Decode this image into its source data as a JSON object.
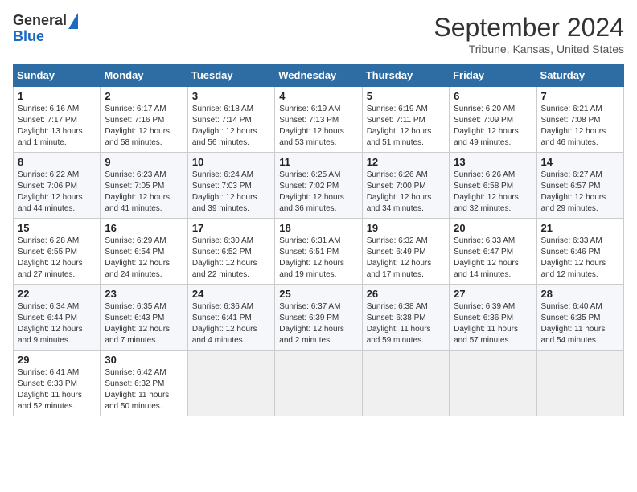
{
  "header": {
    "logo_general": "General",
    "logo_blue": "Blue",
    "month": "September 2024",
    "location": "Tribune, Kansas, United States"
  },
  "days_of_week": [
    "Sunday",
    "Monday",
    "Tuesday",
    "Wednesday",
    "Thursday",
    "Friday",
    "Saturday"
  ],
  "weeks": [
    [
      {
        "day": "1",
        "info": "Sunrise: 6:16 AM\nSunset: 7:17 PM\nDaylight: 13 hours\nand 1 minute."
      },
      {
        "day": "2",
        "info": "Sunrise: 6:17 AM\nSunset: 7:16 PM\nDaylight: 12 hours\nand 58 minutes."
      },
      {
        "day": "3",
        "info": "Sunrise: 6:18 AM\nSunset: 7:14 PM\nDaylight: 12 hours\nand 56 minutes."
      },
      {
        "day": "4",
        "info": "Sunrise: 6:19 AM\nSunset: 7:13 PM\nDaylight: 12 hours\nand 53 minutes."
      },
      {
        "day": "5",
        "info": "Sunrise: 6:19 AM\nSunset: 7:11 PM\nDaylight: 12 hours\nand 51 minutes."
      },
      {
        "day": "6",
        "info": "Sunrise: 6:20 AM\nSunset: 7:09 PM\nDaylight: 12 hours\nand 49 minutes."
      },
      {
        "day": "7",
        "info": "Sunrise: 6:21 AM\nSunset: 7:08 PM\nDaylight: 12 hours\nand 46 minutes."
      }
    ],
    [
      {
        "day": "8",
        "info": "Sunrise: 6:22 AM\nSunset: 7:06 PM\nDaylight: 12 hours\nand 44 minutes."
      },
      {
        "day": "9",
        "info": "Sunrise: 6:23 AM\nSunset: 7:05 PM\nDaylight: 12 hours\nand 41 minutes."
      },
      {
        "day": "10",
        "info": "Sunrise: 6:24 AM\nSunset: 7:03 PM\nDaylight: 12 hours\nand 39 minutes."
      },
      {
        "day": "11",
        "info": "Sunrise: 6:25 AM\nSunset: 7:02 PM\nDaylight: 12 hours\nand 36 minutes."
      },
      {
        "day": "12",
        "info": "Sunrise: 6:26 AM\nSunset: 7:00 PM\nDaylight: 12 hours\nand 34 minutes."
      },
      {
        "day": "13",
        "info": "Sunrise: 6:26 AM\nSunset: 6:58 PM\nDaylight: 12 hours\nand 32 minutes."
      },
      {
        "day": "14",
        "info": "Sunrise: 6:27 AM\nSunset: 6:57 PM\nDaylight: 12 hours\nand 29 minutes."
      }
    ],
    [
      {
        "day": "15",
        "info": "Sunrise: 6:28 AM\nSunset: 6:55 PM\nDaylight: 12 hours\nand 27 minutes."
      },
      {
        "day": "16",
        "info": "Sunrise: 6:29 AM\nSunset: 6:54 PM\nDaylight: 12 hours\nand 24 minutes."
      },
      {
        "day": "17",
        "info": "Sunrise: 6:30 AM\nSunset: 6:52 PM\nDaylight: 12 hours\nand 22 minutes."
      },
      {
        "day": "18",
        "info": "Sunrise: 6:31 AM\nSunset: 6:51 PM\nDaylight: 12 hours\nand 19 minutes."
      },
      {
        "day": "19",
        "info": "Sunrise: 6:32 AM\nSunset: 6:49 PM\nDaylight: 12 hours\nand 17 minutes."
      },
      {
        "day": "20",
        "info": "Sunrise: 6:33 AM\nSunset: 6:47 PM\nDaylight: 12 hours\nand 14 minutes."
      },
      {
        "day": "21",
        "info": "Sunrise: 6:33 AM\nSunset: 6:46 PM\nDaylight: 12 hours\nand 12 minutes."
      }
    ],
    [
      {
        "day": "22",
        "info": "Sunrise: 6:34 AM\nSunset: 6:44 PM\nDaylight: 12 hours\nand 9 minutes."
      },
      {
        "day": "23",
        "info": "Sunrise: 6:35 AM\nSunset: 6:43 PM\nDaylight: 12 hours\nand 7 minutes."
      },
      {
        "day": "24",
        "info": "Sunrise: 6:36 AM\nSunset: 6:41 PM\nDaylight: 12 hours\nand 4 minutes."
      },
      {
        "day": "25",
        "info": "Sunrise: 6:37 AM\nSunset: 6:39 PM\nDaylight: 12 hours\nand 2 minutes."
      },
      {
        "day": "26",
        "info": "Sunrise: 6:38 AM\nSunset: 6:38 PM\nDaylight: 11 hours\nand 59 minutes."
      },
      {
        "day": "27",
        "info": "Sunrise: 6:39 AM\nSunset: 6:36 PM\nDaylight: 11 hours\nand 57 minutes."
      },
      {
        "day": "28",
        "info": "Sunrise: 6:40 AM\nSunset: 6:35 PM\nDaylight: 11 hours\nand 54 minutes."
      }
    ],
    [
      {
        "day": "29",
        "info": "Sunrise: 6:41 AM\nSunset: 6:33 PM\nDaylight: 11 hours\nand 52 minutes."
      },
      {
        "day": "30",
        "info": "Sunrise: 6:42 AM\nSunset: 6:32 PM\nDaylight: 11 hours\nand 50 minutes."
      },
      {
        "day": "",
        "info": ""
      },
      {
        "day": "",
        "info": ""
      },
      {
        "day": "",
        "info": ""
      },
      {
        "day": "",
        "info": ""
      },
      {
        "day": "",
        "info": ""
      }
    ]
  ]
}
